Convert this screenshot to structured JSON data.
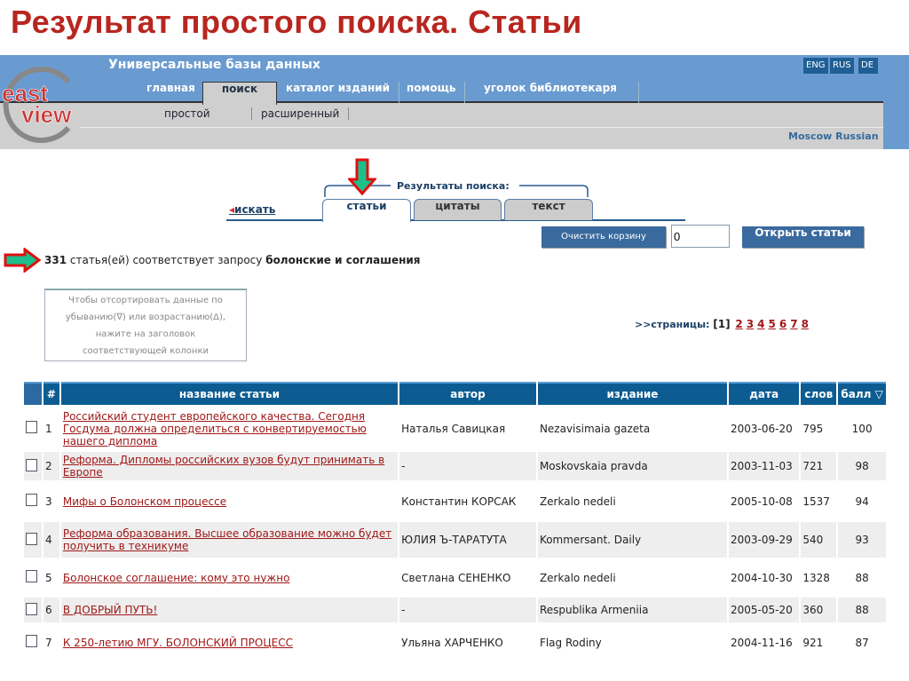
{
  "slide_title": "Результат простого поиска. Статьи",
  "header": {
    "db_title": "Универсальные базы данных",
    "logo_text": [
      "east",
      "view"
    ],
    "languages": [
      "ENG",
      "RUS",
      "DE"
    ],
    "nav_tabs": [
      "главная",
      "поиск",
      "каталог изданий",
      "помощь",
      "уголок библиотекаря"
    ],
    "sub_tabs": [
      "простой",
      "расширенный"
    ],
    "location": "Moscow Russian"
  },
  "results": {
    "group_label": "Результаты поиска:",
    "back_link": "искать",
    "tabs": [
      "статьи",
      "цитаты",
      "текст"
    ],
    "clear_cart": "Очистить корзину",
    "cart_count": "0",
    "open_articles": "Открыть статьи",
    "count": "331",
    "count_text": " статья(ей) соответствует запросу ",
    "query": "болонские и соглашения",
    "sort_hint": [
      "Чтобы отсортировать данные по",
      "убыванию(∇) или возрастанию(Δ),",
      "нажите на заголовок",
      "соответствующей колонки"
    ],
    "pages_label": ">>страницы:",
    "current_page": "[1]",
    "pages": [
      "2",
      "3",
      "4",
      "5",
      "6",
      "7",
      "8"
    ]
  },
  "colors": {
    "title_red": "#b8261f",
    "header_blue": "#6a9bd0",
    "table_head": "#0c5c92",
    "link": "#a01818",
    "arrow_green": "#1dbf8c"
  },
  "table": {
    "headers": [
      "#",
      "название статьи",
      "автор",
      "издание",
      "дата",
      "слов",
      "балл ▽"
    ],
    "rows": [
      {
        "n": "1",
        "title": "Российский студент европейского качества. Сегодня Госдума должна определиться с конвертируемостью нашего диплома",
        "author": "Наталья Савицкая",
        "source": "Nezavisimaia gazeta",
        "date": "2003-06-20",
        "words": "795",
        "score": "100"
      },
      {
        "n": "2",
        "title": "Реформа. Дипломы российских вузов будут принимать в Европе",
        "author": "-",
        "source": "Moskovskaia pravda",
        "date": "2003-11-03",
        "words": "721",
        "score": "98"
      },
      {
        "n": "3",
        "title": "Мифы о Болонском процессе",
        "author": "Константин КОРСАК",
        "source": "Zerkalo nedeli",
        "date": "2005-10-08",
        "words": "1537",
        "score": "94"
      },
      {
        "n": "4",
        "title": "Реформа образования. Высшее образование можно будет получить в техникуме",
        "author": "ЮЛИЯ Ъ-ТАРАТУТА",
        "source": "Kommersant. Daily",
        "date": "2003-09-29",
        "words": "540",
        "score": "93"
      },
      {
        "n": "5",
        "title": "Болонское соглашение: кому это нужно",
        "author": "Светлана СЕНЕНКО",
        "source": "Zerkalo nedeli",
        "date": "2004-10-30",
        "words": "1328",
        "score": "88"
      },
      {
        "n": "6",
        "title": "В ДОБРЫЙ ПУТЬ!",
        "author": "-",
        "source": "Respublika Armeniia",
        "date": "2005-05-20",
        "words": "360",
        "score": "88"
      },
      {
        "n": "7",
        "title": "К 250-летию МГУ. БОЛОНСКИЙ ПРОЦЕСС",
        "author": "Ульяна ХАРЧЕНКО",
        "source": "Flag Rodiny",
        "date": "2004-11-16",
        "words": "921",
        "score": "87"
      }
    ]
  }
}
